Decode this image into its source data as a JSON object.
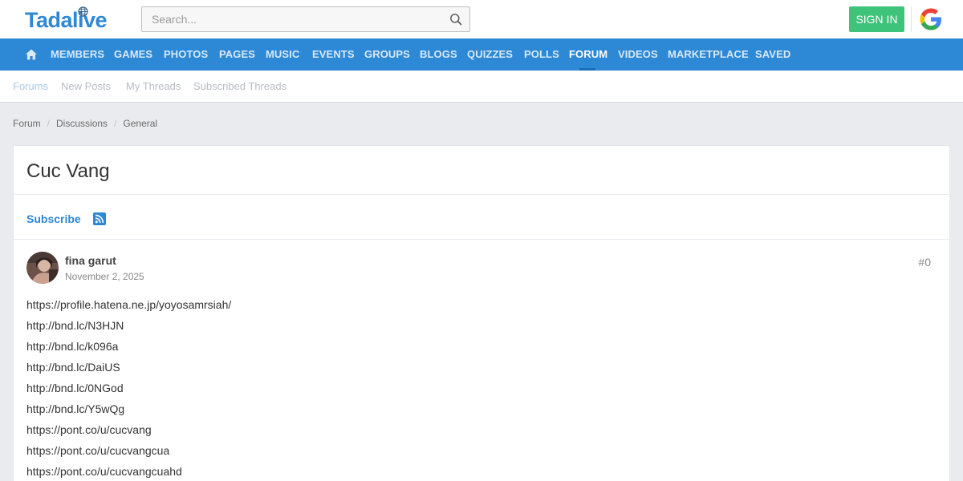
{
  "header": {
    "logo_text": "Tadalive",
    "search_placeholder": "Search...",
    "signin_label": "SIGN IN"
  },
  "nav": {
    "items": [
      {
        "label": "MEMBERS"
      },
      {
        "label": "GAMES"
      },
      {
        "label": "PHOTOS"
      },
      {
        "label": "PAGES"
      },
      {
        "label": "MUSIC"
      },
      {
        "label": "EVENTS"
      },
      {
        "label": "GROUPS"
      },
      {
        "label": "BLOGS"
      },
      {
        "label": "QUIZZES"
      },
      {
        "label": "POLLS"
      },
      {
        "label": "FORUM",
        "active": true
      },
      {
        "label": "VIDEOS"
      },
      {
        "label": "MARKETPLACE"
      },
      {
        "label": "SAVED"
      }
    ]
  },
  "subnav": {
    "items": [
      {
        "label": "Forums",
        "active": true
      },
      {
        "label": "New Posts"
      },
      {
        "label": "My Threads"
      },
      {
        "label": "Subscribed Threads"
      }
    ]
  },
  "breadcrumb": [
    "Forum",
    "Discussions",
    "General"
  ],
  "thread": {
    "title": "Cuc Vang",
    "subscribe_label": "Subscribe"
  },
  "post": {
    "author": "fina garut",
    "date": "November 2, 2025",
    "number": "#0",
    "lines": [
      "https://profile.hatena.ne.jp/yoyosamrsiah/",
      "http://bnd.lc/N3HJN",
      "http://bnd.lc/k096a",
      "http://bnd.lc/DaiUS",
      "http://bnd.lc/0NGod",
      "http://bnd.lc/Y5wQg",
      "https://pont.co/u/cucvang",
      "https://pont.co/u/cucvangcua",
      "https://pont.co/u/cucvangcuahd"
    ]
  },
  "colors": {
    "brand_blue": "#2d88d6",
    "signin_green": "#3ec37a",
    "page_bg": "#e9ebee"
  },
  "icons": [
    "globe-icon",
    "search-icon",
    "google-icon",
    "home-icon",
    "rss-icon"
  ]
}
